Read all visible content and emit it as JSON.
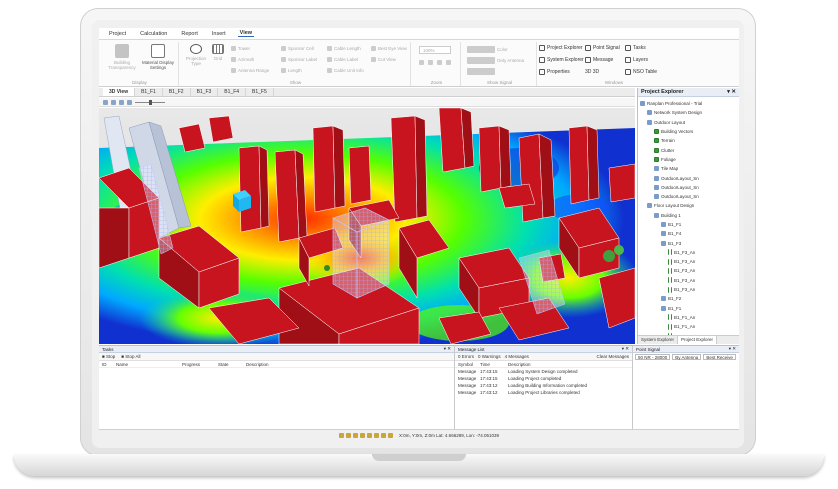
{
  "ribbon": {
    "tabs": [
      "Project",
      "Calculation",
      "Report",
      "Insert",
      "View"
    ],
    "active_tab": "View",
    "display_group": {
      "label": "Display",
      "building_transparency": "Building Transparency",
      "material_display_settings": "Material Display Settings"
    },
    "show_group": {
      "label": "Show",
      "projection_type": "Projection Type",
      "grid": "Grid",
      "tower": "Tower",
      "azimuth": "Azimuth",
      "antenna_range": "Antenna Range",
      "sponsor_cell": "Sponsor Cell",
      "sponsor_label": "Sponsor Label",
      "length": "Length",
      "cable_length": "Cable Length",
      "cable_label": "Cable Label",
      "cable_unit_info": "Cable Unit Info",
      "best_eye_view": "Best Eye View",
      "cut_view": "Cut View"
    },
    "zoom_group": {
      "label": "Zoom",
      "value": "100%"
    },
    "signal_group": {
      "label": "Show Signal",
      "color": "Color",
      "only_antenna": "Only Antenna"
    },
    "windows_group": {
      "label": "Windows",
      "project_explorer": "Project Explorer",
      "point_signal": "Point Signal",
      "tasks": "Tasks",
      "system_explorer": "System Explorer",
      "message": "Message",
      "layers": "Layers",
      "properties": "Properties",
      "view_3d": "3D 3D",
      "nso_table": "NSO Table"
    }
  },
  "doc_tabs": [
    "3D View",
    "B1_F1",
    "B1_F2",
    "B1_F3",
    "B1_F4",
    "B1_F5"
  ],
  "project_explorer": {
    "title": "Project Explorer",
    "items": [
      {
        "label": "Ranplan Professional - Trial",
        "indent": 0,
        "type": "icon"
      },
      {
        "label": "Network System Design",
        "indent": 1,
        "type": "icon"
      },
      {
        "label": "Outdoor Layout",
        "indent": 1,
        "type": "icon"
      },
      {
        "label": "Building Vectors",
        "indent": 2,
        "type": "check"
      },
      {
        "label": "Terrain",
        "indent": 2,
        "type": "check"
      },
      {
        "label": "Clutter",
        "indent": 2,
        "type": "check"
      },
      {
        "label": "Foliage",
        "indent": 2,
        "type": "check"
      },
      {
        "label": "Tile Map",
        "indent": 2,
        "type": "icon"
      },
      {
        "label": "OutdoorLayout_Sn",
        "indent": 2,
        "type": "icon"
      },
      {
        "label": "OutdoorLayout_Sn",
        "indent": 2,
        "type": "icon"
      },
      {
        "label": "OutdoorLayout_Sn",
        "indent": 2,
        "type": "icon"
      },
      {
        "label": "Floor Layout Design",
        "indent": 1,
        "type": "icon"
      },
      {
        "label": "Building 1",
        "indent": 2,
        "type": "icon"
      },
      {
        "label": "B1_F1",
        "indent": 3,
        "type": "icon"
      },
      {
        "label": "B1_F4",
        "indent": 3,
        "type": "icon"
      },
      {
        "label": "B1_F3",
        "indent": 3,
        "type": "icon"
      },
      {
        "label": "B1_F3_An",
        "indent": 4,
        "type": "ant"
      },
      {
        "label": "B1_F3_An",
        "indent": 4,
        "type": "ant"
      },
      {
        "label": "B1_F3_An",
        "indent": 4,
        "type": "ant"
      },
      {
        "label": "B1_F3_An",
        "indent": 4,
        "type": "ant"
      },
      {
        "label": "B1_F3_An",
        "indent": 4,
        "type": "ant"
      },
      {
        "label": "B1_F2",
        "indent": 3,
        "type": "icon"
      },
      {
        "label": "B1_F1",
        "indent": 3,
        "type": "icon"
      },
      {
        "label": "B1_F1_An",
        "indent": 4,
        "type": "ant"
      },
      {
        "label": "B1_F1_An",
        "indent": 4,
        "type": "ant"
      },
      {
        "label": "B1_F1_An",
        "indent": 4,
        "type": "ant"
      }
    ],
    "bottom_tabs": [
      "System Explorer",
      "Project Explorer"
    ]
  },
  "tasks": {
    "title": "Tasks",
    "stop": "Stop",
    "stop_all": "Stop All",
    "columns": [
      "ID",
      "Name",
      "Progress",
      "State",
      "Description"
    ]
  },
  "messages": {
    "title": "Message List",
    "filters": [
      "0 Errors",
      "0 Warnings",
      "4 Messages"
    ],
    "clear": "Clear Messages",
    "columns": [
      "Symbol",
      "Time",
      "Description"
    ],
    "rows": [
      {
        "symbol": "Message",
        "time": "17:43:15",
        "desc": "Loading System Design completed"
      },
      {
        "symbol": "Message",
        "time": "17:43:15",
        "desc": "Loading Project completed"
      },
      {
        "symbol": "Message",
        "time": "17:43:12",
        "desc": "Loading Building Information completed"
      },
      {
        "symbol": "Message",
        "time": "17:43:12",
        "desc": "Loading Project Libraries completed"
      }
    ]
  },
  "point_signal": {
    "title": "Point Signal",
    "selectors": [
      "50 NR - 28000",
      "By Antenna",
      "Best Receive"
    ]
  },
  "status": {
    "coords": "X:0m, Y:0m, Z:0m Lat: 4.666289, Lon: -74.051039"
  },
  "colors": {
    "building": "#c8141e",
    "accent": "#2a6bc0"
  }
}
